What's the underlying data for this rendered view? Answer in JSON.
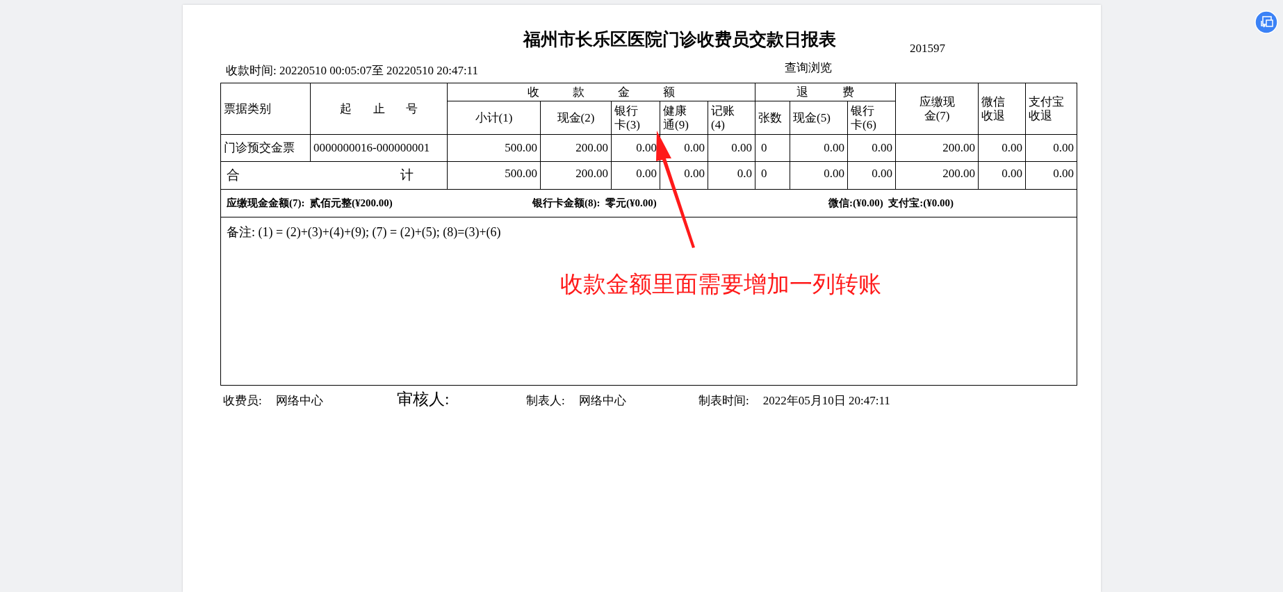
{
  "report": {
    "title": "福州市长乐区医院门诊收费员交款日报表",
    "code": "201597",
    "period": "收款时间: 20220510 00:05:07至 20220510 20:47:11",
    "view_label": "查询浏览",
    "table": {
      "header_top": [
        {
          "lines": [
            "票据类别"
          ]
        },
        {
          "lines": [
            "起 止 号"
          ]
        },
        {
          "lines": [
            "收 款 金 额"
          ]
        },
        {
          "lines": [
            "退 费"
          ]
        },
        {
          "lines": [
            "应缴现",
            "金(7)"
          ]
        },
        {
          "lines": [
            "微信",
            "收退"
          ]
        },
        {
          "lines": [
            "支付宝",
            "收退"
          ]
        }
      ],
      "header_sub": [
        {
          "lines": [
            "小计(1)"
          ]
        },
        {
          "lines": [
            "现金(2)"
          ]
        },
        {
          "lines": [
            "银行",
            "卡(3)"
          ]
        },
        {
          "lines": [
            "健康",
            "通(9)"
          ]
        },
        {
          "lines": [
            "记账",
            "(4)"
          ]
        },
        {
          "lines": [
            "张数"
          ]
        },
        {
          "lines": [
            "现金(5)"
          ]
        },
        {
          "lines": [
            "银行",
            "卡(6)"
          ]
        }
      ],
      "rows": [
        {
          "cells": [
            "门诊预交金票",
            "0000000016-000000001",
            "500.00",
            "200.00",
            "0.00",
            "0.00",
            "0.00",
            "0",
            "0.00",
            "0.00",
            "200.00",
            "0.00",
            "0.00"
          ]
        }
      ],
      "total": {
        "label_left": "合",
        "label_right": "计",
        "cells": [
          "500.00",
          "200.00",
          "0.00",
          "0.00",
          "0.0",
          "0",
          "0.00",
          "0.00",
          "200.00",
          "0.00",
          "0.00"
        ]
      }
    },
    "summary": [
      "应缴现金金额(7):  贰佰元整(¥200.00)",
      "银行卡金额(8):  零元(¥0.00)",
      "微信:(¥0.00)  支付宝:(¥0.00)"
    ],
    "note": "备注: (1) = (2)+(3)+(4)+(9); (7) = (2)+(5); (8)=(3)+(6)",
    "footer": [
      {
        "label": "收费员:",
        "value": "网络中心"
      },
      {
        "label": "审核人:"
      },
      {
        "label": "制表人:",
        "value": "网络中心"
      },
      {
        "label": "制表时间:",
        "value": "2022年05月10日 20:47:11"
      }
    ]
  },
  "annotation": {
    "text": "收款金额里面需要增加一列转账"
  }
}
